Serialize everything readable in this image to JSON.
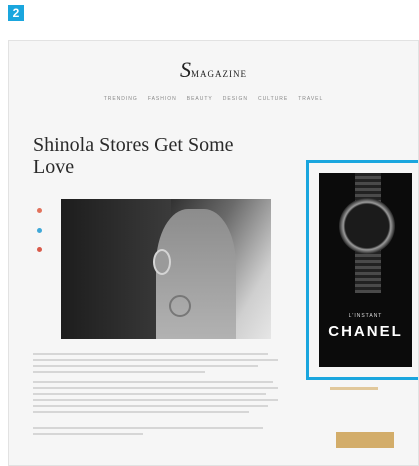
{
  "badge": "2",
  "site": {
    "logo_initial": "S",
    "logo_rest": "MAGAZINE"
  },
  "nav": [
    "TRENDING",
    "FASHION",
    "BEAUTY",
    "DESIGN",
    "CULTURE",
    "TRAVEL"
  ],
  "article": {
    "title": "Shinola Stores Get Some Love"
  },
  "ad": {
    "tagline": "L'INSTANT",
    "brand": "CHANEL",
    "highlight_color": "#1aa6de"
  },
  "colors": {
    "accent_gold": "#d3ad6a",
    "outline_blue": "#1aa6de"
  }
}
